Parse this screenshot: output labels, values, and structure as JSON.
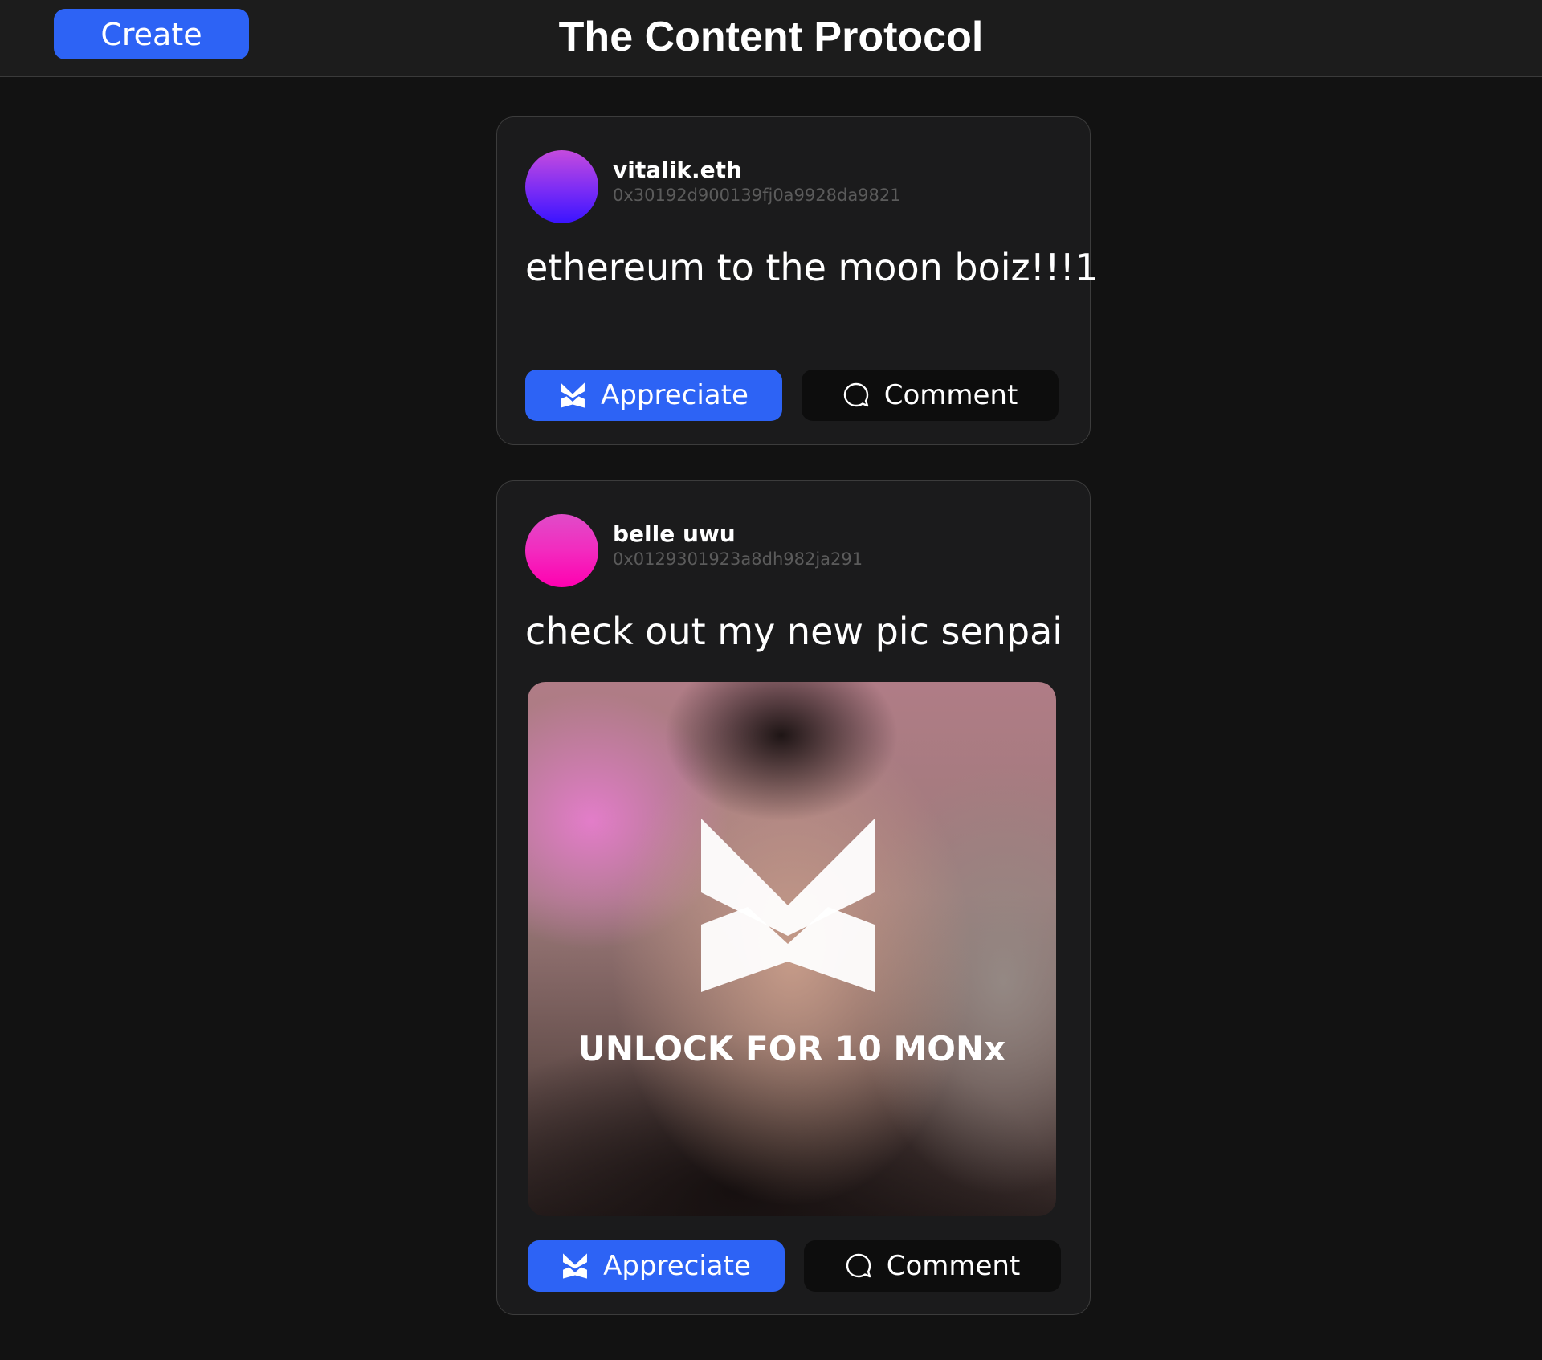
{
  "header": {
    "create_label": "Create",
    "title": "The Content Protocol"
  },
  "colors": {
    "accent": "#2d63f5",
    "background": "#121212",
    "card": "#1b1b1c"
  },
  "posts": [
    {
      "username": "vitalik.eth",
      "address": "0x30192d900139fj0a9928da9821",
      "text": "ethereum to the moon boiz!!!1",
      "avatar": "purple-gradient-avatar",
      "appreciate_label": "Appreciate",
      "comment_label": "Comment"
    },
    {
      "username": "belle uwu",
      "address": "0x0129301923a8dh982ja291",
      "text": "check out my new pic senpai",
      "avatar": "pink-gradient-avatar",
      "locked_media": {
        "unlock_label": "UNLOCK FOR 10 MONx",
        "icon": "monx-logo-icon"
      },
      "appreciate_label": "Appreciate",
      "comment_label": "Comment"
    }
  ]
}
